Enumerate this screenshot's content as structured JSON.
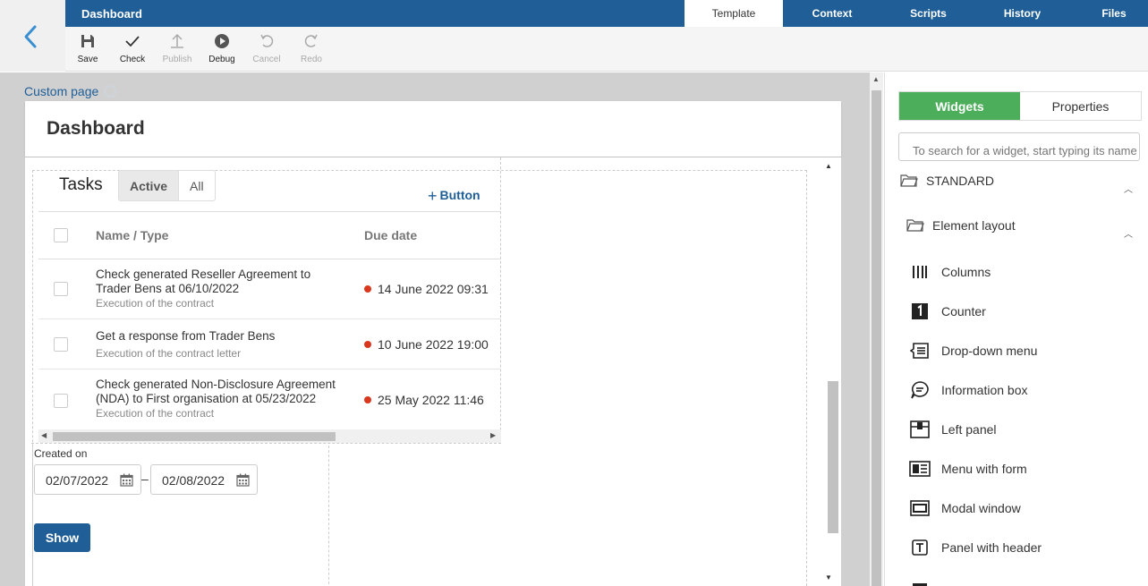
{
  "header": {
    "app_title": "Dashboard",
    "tabs": [
      {
        "label": "Template",
        "active": true
      },
      {
        "label": "Context",
        "active": false
      },
      {
        "label": "Scripts",
        "active": false
      },
      {
        "label": "History",
        "active": false
      },
      {
        "label": "Files",
        "active": false
      }
    ],
    "accent_color": "#1f5e97"
  },
  "toolbar": {
    "save": "Save",
    "check": "Check",
    "publish": "Publish",
    "debug": "Debug",
    "cancel": "Cancel",
    "redo": "Redo"
  },
  "canvas": {
    "breadcrumb": "Custom page",
    "page_title": "Dashboard"
  },
  "tasks": {
    "title": "Tasks",
    "filter_tabs": [
      "Active",
      "All"
    ],
    "add_button": "Button",
    "columns": [
      "Name / Type",
      "Due date"
    ],
    "rows": [
      {
        "name": "Check generated Reseller Agreement to Trader Bens at 06/10/2022",
        "type": "Execution of the contract",
        "due": "14 June 2022 09:31"
      },
      {
        "name": "Get a response from Trader Bens",
        "type": "Execution of the contract letter",
        "due": "10 June 2022 19:00"
      },
      {
        "name": "Check generated Non-Disclosure Agreement (NDA) to First organisation at 05/23/2022",
        "type": "Execution of the contract",
        "due": "25 May 2022 11:46"
      }
    ]
  },
  "filter": {
    "label": "Created on",
    "from": "02/07/2022",
    "separator": "–",
    "to": "02/08/2022",
    "show_button": "Show"
  },
  "right_panel": {
    "tabs": [
      {
        "label": "Widgets",
        "active": true
      },
      {
        "label": "Properties",
        "active": false
      }
    ],
    "search_placeholder": "To search for a widget, start typing its name",
    "group_standard": "STANDARD",
    "group_layout": "Element layout",
    "widgets": [
      {
        "label": "Columns",
        "icon": "columns-icon"
      },
      {
        "label": "Counter",
        "icon": "counter-icon"
      },
      {
        "label": "Drop-down menu",
        "icon": "dropdown-menu-icon"
      },
      {
        "label": "Information box",
        "icon": "information-box-icon"
      },
      {
        "label": "Left panel",
        "icon": "left-panel-icon"
      },
      {
        "label": "Menu with form",
        "icon": "menu-with-form-icon"
      },
      {
        "label": "Modal window",
        "icon": "modal-window-icon"
      },
      {
        "label": "Panel with header",
        "icon": "panel-with-header-icon"
      }
    ],
    "accent_color": "#4cae5a"
  }
}
